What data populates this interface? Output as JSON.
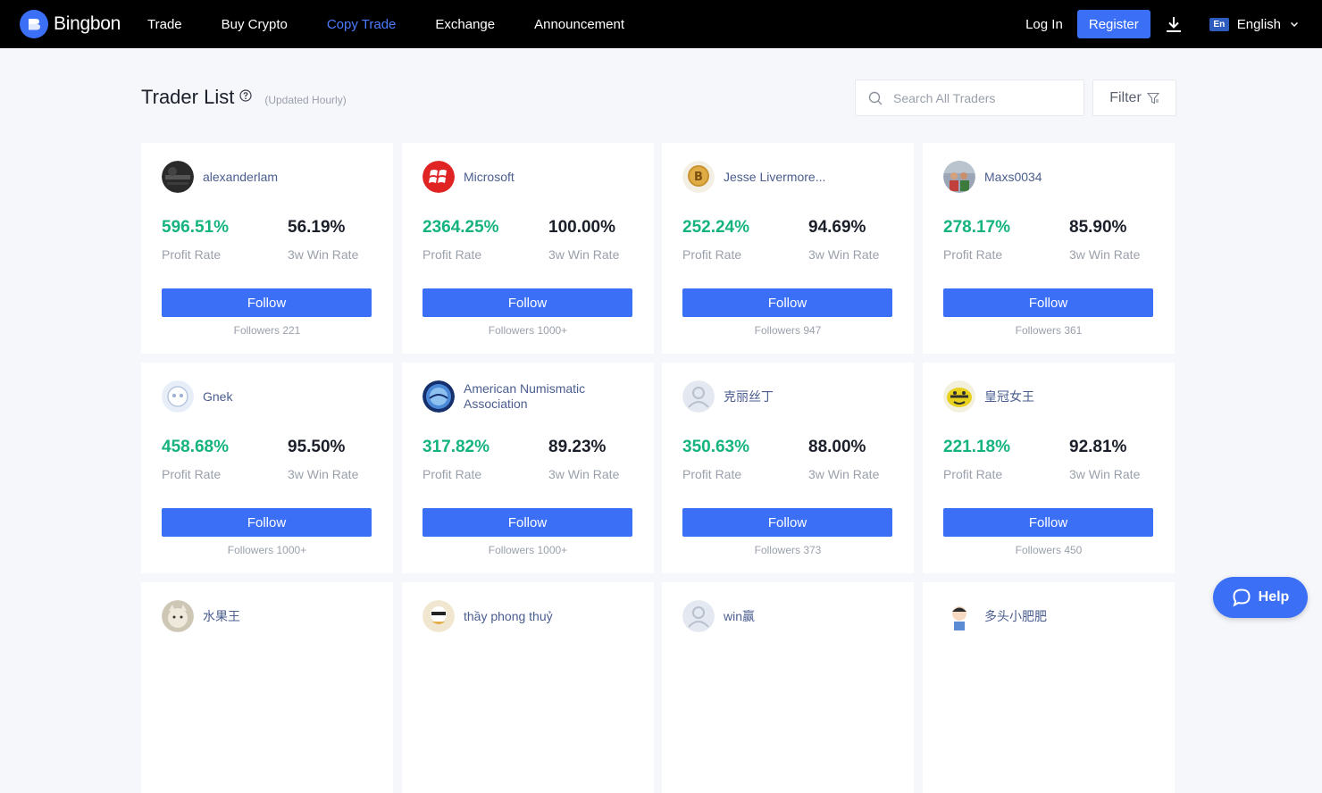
{
  "brand": {
    "name": "Bingbon"
  },
  "nav": {
    "links": [
      {
        "label": "Trade",
        "active": false
      },
      {
        "label": "Buy Crypto",
        "active": false
      },
      {
        "label": "Copy Trade",
        "active": true
      },
      {
        "label": "Exchange",
        "active": false
      },
      {
        "label": "Announcement",
        "active": false
      }
    ],
    "login_label": "Log In",
    "register_label": "Register",
    "language": {
      "badge": "En",
      "name": "English"
    }
  },
  "header": {
    "title": "Trader List",
    "updated": "(Updated Hourly)",
    "search_placeholder": "Search All Traders",
    "filter_label": "Filter"
  },
  "stat_labels": {
    "profit": "Profit Rate",
    "win": "3w Win Rate"
  },
  "follow_label": "Follow",
  "traders": [
    {
      "name": "alexanderlam",
      "profit_rate": "596.51%",
      "win_rate": "56.19%",
      "followers": "Followers 221",
      "avatar": "dark-photo"
    },
    {
      "name": "Microsoft",
      "profit_rate": "2364.25%",
      "win_rate": "100.00%",
      "followers": "Followers 1000+",
      "avatar": "microsoft-logo"
    },
    {
      "name": "Jesse Livermore...",
      "profit_rate": "252.24%",
      "win_rate": "94.69%",
      "followers": "Followers 947",
      "avatar": "bitcoin-coin"
    },
    {
      "name": "Maxs0034",
      "profit_rate": "278.17%",
      "win_rate": "85.90%",
      "followers": "Followers 361",
      "avatar": "group-photo"
    },
    {
      "name": "Gnek",
      "profit_rate": "458.68%",
      "win_rate": "95.50%",
      "followers": "Followers 1000+",
      "avatar": "light-bubble"
    },
    {
      "name": "American Numismatic Association",
      "profit_rate": "317.82%",
      "win_rate": "89.23%",
      "followers": "Followers 1000+",
      "avatar": "blue-seal"
    },
    {
      "name": "克丽丝丁",
      "profit_rate": "350.63%",
      "win_rate": "88.00%",
      "followers": "Followers 373",
      "avatar": "default-user"
    },
    {
      "name": "皇冠女王",
      "profit_rate": "221.18%",
      "win_rate": "92.81%",
      "followers": "Followers 450",
      "avatar": "yellow-crown"
    },
    {
      "name": "水果王",
      "avatar": "cat-photo"
    },
    {
      "name": "thầy phong thuỷ",
      "avatar": "cartoon-photo"
    },
    {
      "name": "win赢",
      "avatar": "default-user"
    },
    {
      "name": "多头小肥肥",
      "avatar": "cartoon-kid"
    }
  ],
  "help_label": "Help",
  "colors": {
    "accent": "#3b6ff5",
    "profit": "#14b37f",
    "nav_bg": "#000000",
    "nav_active": "#4d7bff"
  }
}
